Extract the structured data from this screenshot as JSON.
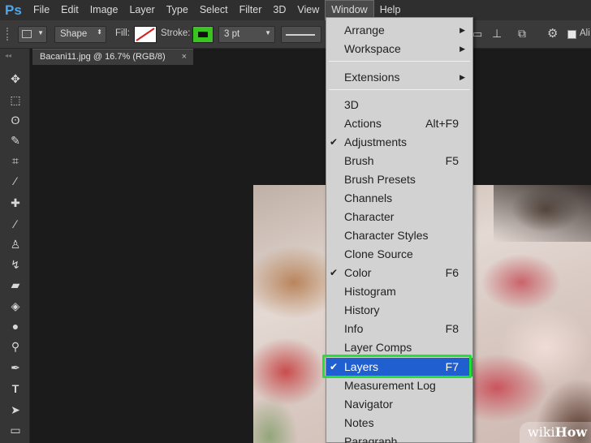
{
  "app": {
    "logo": "Ps"
  },
  "menubar": {
    "items": [
      "File",
      "Edit",
      "Image",
      "Layer",
      "Type",
      "Select",
      "Filter",
      "3D",
      "View",
      "Window",
      "Help"
    ]
  },
  "options": {
    "shape_mode": "Shape",
    "fill_label": "Fill:",
    "stroke_label": "Stroke:",
    "stroke_color": "#39c51f",
    "stroke_width": "3 pt",
    "align_edges_label": "Ali"
  },
  "document": {
    "tab_title": "Bacani11.jpg @ 16.7% (RGB/8)",
    "close_glyph": "×"
  },
  "window_menu": {
    "items": [
      {
        "label": "Arrange",
        "shortcut": "",
        "checked": false,
        "submenu": true
      },
      {
        "label": "Workspace",
        "shortcut": "",
        "checked": false,
        "submenu": true
      },
      {
        "label": "Extensions",
        "shortcut": "",
        "checked": false,
        "submenu": true
      },
      {
        "label": "3D",
        "shortcut": "",
        "checked": false,
        "submenu": false
      },
      {
        "label": "Actions",
        "shortcut": "Alt+F9",
        "checked": false,
        "submenu": false
      },
      {
        "label": "Adjustments",
        "shortcut": "",
        "checked": true,
        "submenu": false
      },
      {
        "label": "Brush",
        "shortcut": "F5",
        "checked": false,
        "submenu": false
      },
      {
        "label": "Brush Presets",
        "shortcut": "",
        "checked": false,
        "submenu": false
      },
      {
        "label": "Channels",
        "shortcut": "",
        "checked": false,
        "submenu": false
      },
      {
        "label": "Character",
        "shortcut": "",
        "checked": false,
        "submenu": false
      },
      {
        "label": "Character Styles",
        "shortcut": "",
        "checked": false,
        "submenu": false
      },
      {
        "label": "Clone Source",
        "shortcut": "",
        "checked": false,
        "submenu": false
      },
      {
        "label": "Color",
        "shortcut": "F6",
        "checked": true,
        "submenu": false
      },
      {
        "label": "Histogram",
        "shortcut": "",
        "checked": false,
        "submenu": false
      },
      {
        "label": "History",
        "shortcut": "",
        "checked": false,
        "submenu": false
      },
      {
        "label": "Info",
        "shortcut": "F8",
        "checked": false,
        "submenu": false
      },
      {
        "label": "Layer Comps",
        "shortcut": "",
        "checked": false,
        "submenu": false
      },
      {
        "label": "Layers",
        "shortcut": "F7",
        "checked": true,
        "submenu": false,
        "highlighted": true
      },
      {
        "label": "Measurement Log",
        "shortcut": "",
        "checked": false,
        "submenu": false
      },
      {
        "label": "Navigator",
        "shortcut": "",
        "checked": false,
        "submenu": false
      },
      {
        "label": "Notes",
        "shortcut": "",
        "checked": false,
        "submenu": false
      },
      {
        "label": "Paragraph",
        "shortcut": "",
        "checked": false,
        "submenu": false
      }
    ]
  },
  "watermark": {
    "prefix": "wiki",
    "suffix": "How"
  },
  "colors": {
    "highlight": "#1f5fd0",
    "highlight_outline": "#22e038",
    "menu_bg": "#d2d2d2"
  }
}
